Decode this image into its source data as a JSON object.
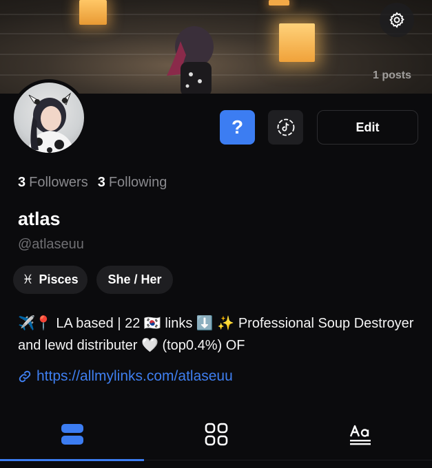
{
  "cover": {
    "posts_count": "1 posts"
  },
  "actions": {
    "question_label": "?",
    "edit_label": "Edit"
  },
  "stats": {
    "followers_count": "3",
    "followers_label": "Followers",
    "following_count": "3",
    "following_label": "Following"
  },
  "profile": {
    "display_name": "atlas",
    "handle": "@atlaseuu",
    "tags": [
      {
        "symbol": "♓",
        "label": "Pisces"
      },
      {
        "label": "She / Her"
      }
    ],
    "bio": "✈️📍 LA based | 22 🇰🇷 links ⬇️ ✨ Professional Soup Destroyer and lewd distributer 🤍 (top0.4%) OF",
    "link": "https://allmylinks.com/atlaseuu"
  },
  "tabs": [
    {
      "icon": "stacked-cards-icon",
      "active": true
    },
    {
      "icon": "grid-icon",
      "active": false
    },
    {
      "icon": "text-aa-icon",
      "active": false
    }
  ],
  "colors": {
    "accent": "#3c7df2",
    "background": "#0b0b0d",
    "muted": "#8a8a8e",
    "link": "#3f7ff0"
  }
}
